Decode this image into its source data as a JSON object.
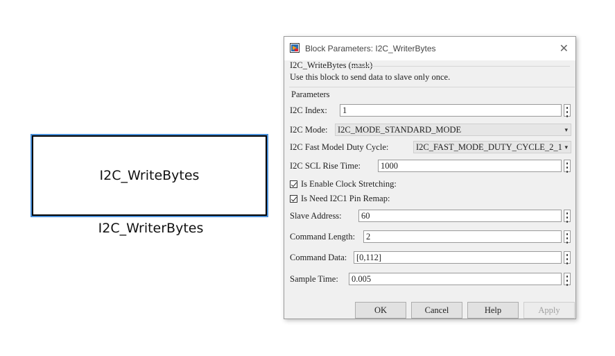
{
  "canvas": {
    "block_label": "I2C_WriteBytes",
    "block_name": "I2C_WriterBytes"
  },
  "dialog": {
    "title": "Block Parameters: I2C_WriterBytes",
    "mask_title": "I2C_WriteBytes (mask)",
    "description": "Use this block to send data to slave only once.",
    "params_title": "Parameters",
    "fields": {
      "i2c_index": {
        "label": "I2C Index:",
        "value": "1"
      },
      "i2c_mode": {
        "label": "I2C Mode:",
        "value": "I2C_MODE_STANDARD_MODE"
      },
      "fast_duty": {
        "label": "I2C Fast Model Duty Cycle:",
        "value": "I2C_FAST_MODE_DUTY_CYCLE_2_1"
      },
      "scl_rise": {
        "label": "I2C SCL Rise Time:",
        "value": "1000"
      },
      "clock_stretch": {
        "label": "Is Enable Clock Stretching:",
        "checked": true
      },
      "pin_remap": {
        "label": "Is Need I2C1 Pin Remap:",
        "checked": true
      },
      "slave_addr": {
        "label": "Slave Address:",
        "value": "60"
      },
      "cmd_len": {
        "label": "Command Length:",
        "value": "2"
      },
      "cmd_data": {
        "label": "Command Data:",
        "value": "[0,112]"
      },
      "sample_time": {
        "label": "Sample Time:",
        "value": "0.005"
      }
    },
    "buttons": {
      "ok": "OK",
      "cancel": "Cancel",
      "help": "Help",
      "apply": "Apply"
    },
    "close_glyph": "✕"
  }
}
